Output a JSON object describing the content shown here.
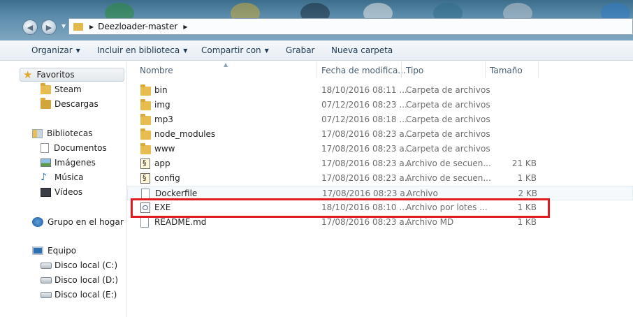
{
  "address": {
    "segments": [
      "Deezloader-master"
    ]
  },
  "toolbar": {
    "organize": "Organizar",
    "include": "Incluir en biblioteca",
    "share": "Compartir con",
    "burn": "Grabar",
    "new_folder": "Nueva carpeta"
  },
  "nav": {
    "favorites": "Favoritos",
    "steam": "Steam",
    "downloads": "Descargas",
    "libraries": "Bibliotecas",
    "documents": "Documentos",
    "images": "Imágenes",
    "music": "Música",
    "videos": "Vídeos",
    "homegroup": "Grupo en el hogar",
    "computer": "Equipo",
    "disk_c": "Disco local (C:)",
    "disk_d": "Disco local (D:)",
    "disk_e": "Disco local (E:)"
  },
  "columns": {
    "name": "Nombre",
    "date": "Fecha de modifica...",
    "type": "Tipo",
    "size": "Tamaño"
  },
  "files": [
    {
      "name": "bin",
      "date": "18/10/2016 08:11 ...",
      "type": "Carpeta de archivos",
      "size": "",
      "icon": "folder-icon"
    },
    {
      "name": "img",
      "date": "07/12/2016 08:23 ...",
      "type": "Carpeta de archivos",
      "size": "",
      "icon": "folder-icon"
    },
    {
      "name": "mp3",
      "date": "07/12/2016 08:18 ...",
      "type": "Carpeta de archivos",
      "size": "",
      "icon": "folder-icon"
    },
    {
      "name": "node_modules",
      "date": "17/08/2016 08:23 a...",
      "type": "Carpeta de archivos",
      "size": "",
      "icon": "folder-icon"
    },
    {
      "name": "www",
      "date": "17/08/2016 08:23 a...",
      "type": "Carpeta de archivos",
      "size": "",
      "icon": "folder-icon"
    },
    {
      "name": "app",
      "date": "17/08/2016 08:23 a...",
      "type": "Archivo de secuen...",
      "size": "21 KB",
      "icon": "script-icon"
    },
    {
      "name": "config",
      "date": "17/08/2016 08:23 a...",
      "type": "Archivo de secuen...",
      "size": "1 KB",
      "icon": "script-icon"
    },
    {
      "name": "Dockerfile",
      "date": "17/08/2016 08:23 a...",
      "type": "Archivo",
      "size": "2 KB",
      "icon": "file-icon"
    },
    {
      "name": "EXE",
      "date": "18/10/2016 08:10 ...",
      "type": "Archivo por lotes ...",
      "size": "1 KB",
      "icon": "batch-file-icon"
    },
    {
      "name": "README.md",
      "date": "17/08/2016 08:23 a...",
      "type": "Archivo MD",
      "size": "1 KB",
      "icon": "file-icon"
    }
  ],
  "colors": {
    "highlight_box": "#e01b24"
  }
}
